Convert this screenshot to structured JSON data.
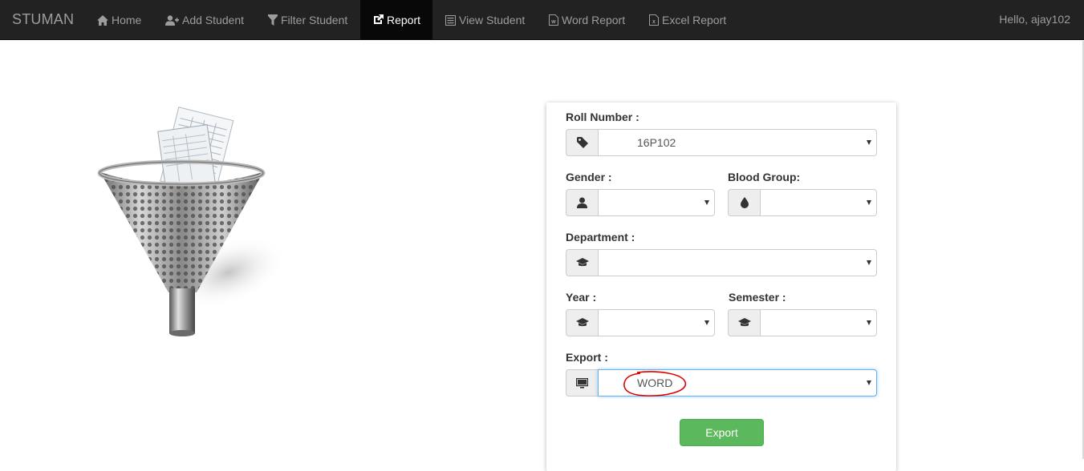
{
  "navbar": {
    "brand": "STUMAN",
    "items": [
      {
        "label": "Home",
        "icon": "home-icon"
      },
      {
        "label": "Add Student",
        "icon": "add-user-icon"
      },
      {
        "label": "Filter Student",
        "icon": "filter-icon"
      },
      {
        "label": "Report",
        "icon": "share-icon",
        "active": true
      },
      {
        "label": "View Student",
        "icon": "list-icon"
      },
      {
        "label": "Word Report",
        "icon": "word-file-icon"
      },
      {
        "label": "Excel Report",
        "icon": "excel-file-icon"
      }
    ],
    "greeting": "Hello, ajay102"
  },
  "form": {
    "roll_number": {
      "label": "Roll Number :",
      "value": "16P102",
      "icon": "tag-icon"
    },
    "gender": {
      "label": "Gender :",
      "value": "",
      "icon": "user-icon"
    },
    "blood_group": {
      "label": "Blood Group:",
      "value": "",
      "icon": "drop-icon"
    },
    "department": {
      "label": "Department :",
      "value": "",
      "icon": "graduation-cap-icon"
    },
    "year": {
      "label": "Year :",
      "value": "",
      "icon": "graduation-cap-icon"
    },
    "semester": {
      "label": "Semester :",
      "value": "",
      "icon": "graduation-cap-icon"
    },
    "export": {
      "label": "Export :",
      "value": "WORD",
      "icon": "monitor-icon"
    },
    "export_button": "Export"
  },
  "colors": {
    "navbar_bg": "#222222",
    "nav_active_bg": "#080808",
    "export_button": "#5cb85c",
    "annotation_circle": "#e00000"
  }
}
